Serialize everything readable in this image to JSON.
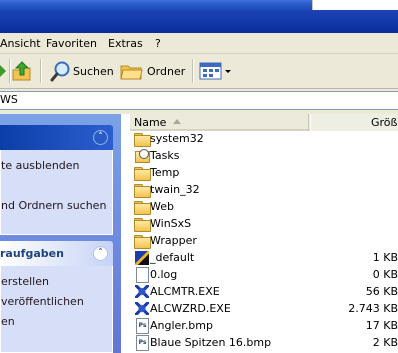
{
  "menu": [
    "Ansicht",
    "Favoriten",
    "Extras",
    "?"
  ],
  "toolbar": {
    "search_label": "Suchen",
    "folders_label": "Ordner"
  },
  "address": {
    "value": "WS"
  },
  "taskpane": {
    "panel1_links": [
      "te ausblenden",
      "nd Ordnern suchen"
    ],
    "panel2_title": "raufgaben",
    "panel2_links": [
      "erstellen",
      "veröffentlichen",
      "en"
    ]
  },
  "columns": {
    "name": "Name",
    "size": "Größe"
  },
  "files": [
    {
      "name": "system32",
      "size": "",
      "icon": "folder-icon"
    },
    {
      "name": "Tasks",
      "size": "",
      "icon": "tasks-folder-icon"
    },
    {
      "name": "Temp",
      "size": "",
      "icon": "folder-icon"
    },
    {
      "name": "twain_32",
      "size": "",
      "icon": "folder-icon"
    },
    {
      "name": "Web",
      "size": "",
      "icon": "folder-icon"
    },
    {
      "name": "WinSxS",
      "size": "",
      "icon": "folder-icon"
    },
    {
      "name": "Wrapper",
      "size": "",
      "icon": "folder-icon"
    },
    {
      "name": "_default",
      "size": "1 KB",
      "icon": "shortcut-icon"
    },
    {
      "name": "0.log",
      "size": "0 KB",
      "icon": "document-icon"
    },
    {
      "name": "ALCMTR.EXE",
      "size": "56 KB",
      "icon": "executable-icon"
    },
    {
      "name": "ALCWZRD.EXE",
      "size": "2.743 KB",
      "icon": "executable-icon"
    },
    {
      "name": "Angler.bmp",
      "size": "17 KB",
      "icon": "bitmap-icon"
    },
    {
      "name": "Blaue Spitzen 16.bmp",
      "size": "2 KB",
      "icon": "bitmap-icon"
    }
  ]
}
